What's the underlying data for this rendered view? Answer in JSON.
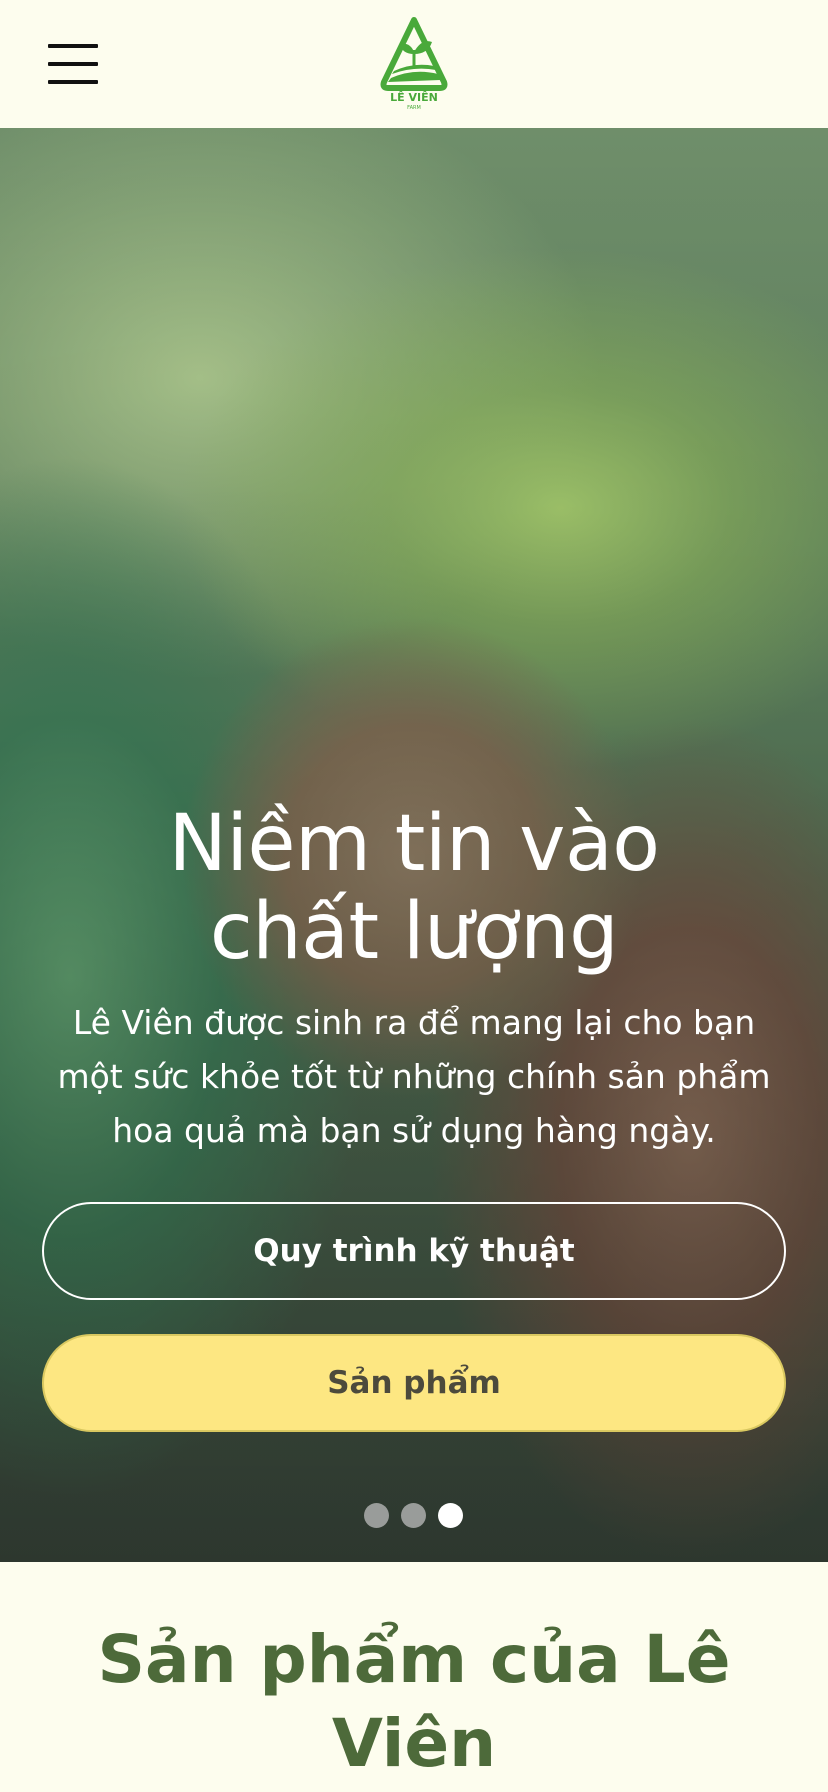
{
  "header": {
    "menu_icon": "hamburger-menu-icon",
    "logo": {
      "icon": "leaf-triangle-logo-icon",
      "name": "LÊ VIÊN",
      "tagline": "FARM",
      "color": "#49a93a"
    }
  },
  "hero": {
    "title_line1": "Niềm tin vào",
    "title_line2": "chất lượng",
    "subtitle_line1": "Lê Viên được sinh ra để mang lại cho bạn",
    "subtitle_line2": "một sức khỏe tốt từ những chính sản phẩm",
    "subtitle_line3": "hoa quả mà bạn sử dụng hàng ngày.",
    "primary_button": "Quy trình kỹ thuật",
    "secondary_button": "Sản phẩm",
    "slide_count": 3,
    "active_slide": 3
  },
  "products": {
    "title": "Sản phẩm của Lê Viên"
  },
  "colors": {
    "page_background": "#fdfdee",
    "accent_yellow": "#fde782",
    "brand_green": "#4d6a3a"
  }
}
